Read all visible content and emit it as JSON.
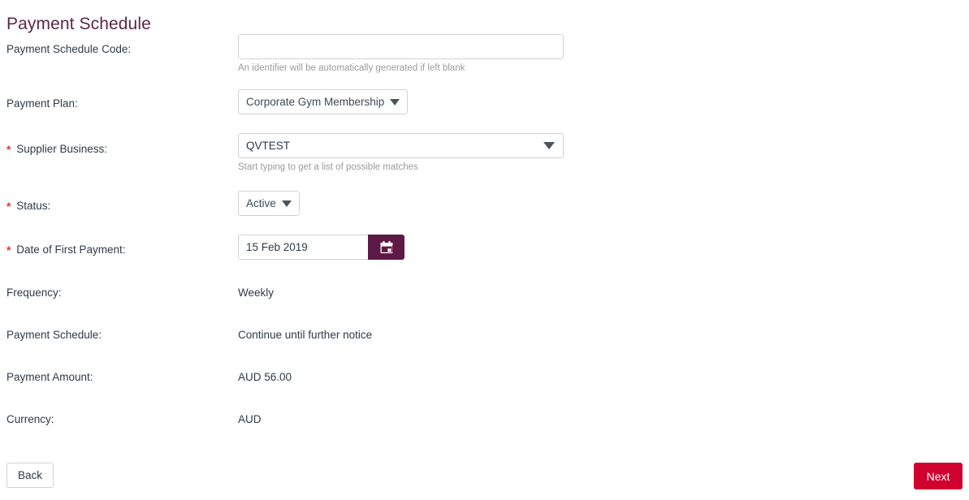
{
  "page": {
    "title": "Payment Schedule"
  },
  "fields": {
    "schedule_code": {
      "label": "Payment Schedule Code:",
      "value": "",
      "placeholder": "",
      "hint": "An identifier will be automatically generated if left blank"
    },
    "payment_plan": {
      "label": "Payment Plan:",
      "value": "Corporate Gym Membership"
    },
    "supplier_business": {
      "label": "Supplier Business:",
      "required_marker": "*",
      "value": "QVTEST",
      "placeholder": "",
      "hint": "Start typing to get a list of possible matches"
    },
    "status": {
      "label": "Status:",
      "required_marker": "*",
      "value": "Active"
    },
    "first_payment_date": {
      "label": "Date of First Payment:",
      "required_marker": "*",
      "value": "15 Feb 2019",
      "placeholder": ""
    },
    "frequency": {
      "label": "Frequency:",
      "value": "Weekly"
    },
    "payment_schedule": {
      "label": "Payment Schedule:",
      "value": "Continue until further notice"
    },
    "payment_amount": {
      "label": "Payment Amount:",
      "value": "AUD 56.00"
    },
    "currency": {
      "label": "Currency:",
      "value": "AUD"
    }
  },
  "footer": {
    "back_label": "Back",
    "next_label": "Next"
  },
  "colors": {
    "title": "#5C2740",
    "required_asterisk": "#E8342A",
    "calendar_button": "#5E1A46",
    "next_button": "#D0002F",
    "label_text": "#2E3A46",
    "hint_text": "#9B9B9B",
    "input_border": "#D6D1CD"
  }
}
